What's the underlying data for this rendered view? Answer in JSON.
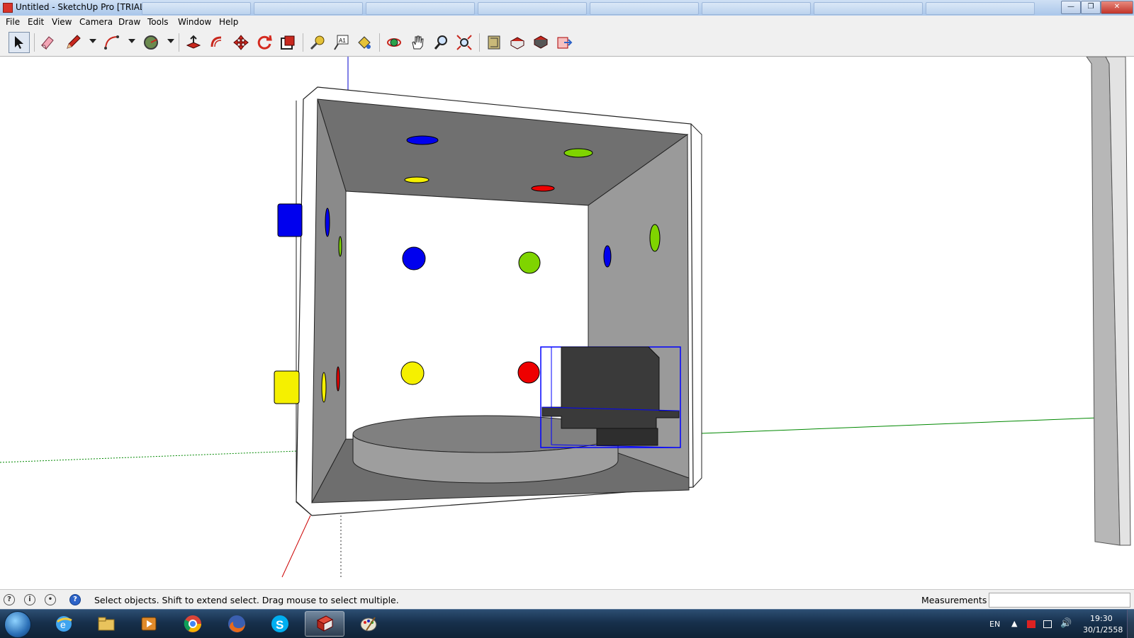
{
  "window": {
    "title": "Untitled - SketchUp Pro [TRIAL]",
    "min_label": "—",
    "max_label": "❐",
    "close_label": "✕"
  },
  "menu": [
    "File",
    "Edit",
    "View",
    "Camera",
    "Draw",
    "Tools",
    "Window",
    "Help"
  ],
  "toolbar": {
    "tools": [
      {
        "name": "select-tool",
        "icon": "arrow-cursor-icon",
        "active": true
      },
      {
        "name": "eraser-tool",
        "icon": "eraser-icon"
      },
      {
        "name": "pencil-tool",
        "icon": "pencil-icon",
        "dropdown": true
      },
      {
        "name": "arc-tool",
        "icon": "arc-icon",
        "dropdown": true
      },
      {
        "name": "shape-tool",
        "icon": "circle-icon",
        "dropdown": true
      },
      {
        "name": "push-pull-tool",
        "icon": "push-pull-icon"
      },
      {
        "name": "offset-tool",
        "icon": "offset-icon"
      },
      {
        "name": "move-tool",
        "icon": "move-icon"
      },
      {
        "name": "rotate-tool",
        "icon": "rotate-icon"
      },
      {
        "name": "scale-tool",
        "icon": "scale-icon"
      },
      {
        "name": "tape-measure-tool",
        "icon": "tape-measure-icon"
      },
      {
        "name": "text-tool",
        "icon": "text-icon",
        "label": "A1"
      },
      {
        "name": "paint-bucket-tool",
        "icon": "paint-bucket-icon"
      },
      {
        "name": "orbit-tool",
        "icon": "orbit-icon"
      },
      {
        "name": "pan-tool",
        "icon": "hand-icon"
      },
      {
        "name": "zoom-tool",
        "icon": "magnifier-icon"
      },
      {
        "name": "zoom-extents-tool",
        "icon": "zoom-extents-icon"
      },
      {
        "name": "warehouse-tool",
        "icon": "warehouse-icon"
      },
      {
        "name": "share-model-tool",
        "icon": "share-model-icon"
      },
      {
        "name": "get-models-tool",
        "icon": "get-models-icon"
      },
      {
        "name": "send-layout-tool",
        "icon": "layout-icon"
      }
    ]
  },
  "colors": {
    "x_axis": "#cc0000",
    "y_axis": "#008800",
    "z_axis": "#0000cc",
    "selection": "#0000ff",
    "hole_blue": "#0000ee",
    "hole_green": "#7fd400",
    "hole_yellow": "#f5f000",
    "hole_red": "#ee0000"
  },
  "status": {
    "hint": "Select objects. Shift to extend select. Drag mouse to select multiple.",
    "measurements_label": "Measurements",
    "measurements_value": ""
  },
  "taskbar": {
    "apps": [
      {
        "name": "internet-explorer",
        "icon": "ie-icon"
      },
      {
        "name": "file-explorer",
        "icon": "folder-icon"
      },
      {
        "name": "media-player",
        "icon": "media-icon"
      },
      {
        "name": "chrome",
        "icon": "chrome-icon"
      },
      {
        "name": "firefox",
        "icon": "firefox-icon"
      },
      {
        "name": "skype",
        "icon": "skype-icon"
      },
      {
        "name": "sketchup",
        "icon": "sketchup-icon",
        "active": true
      },
      {
        "name": "paint",
        "icon": "paint-icon"
      }
    ],
    "language": "EN",
    "time": "19:30",
    "date": "30/1/2558"
  }
}
